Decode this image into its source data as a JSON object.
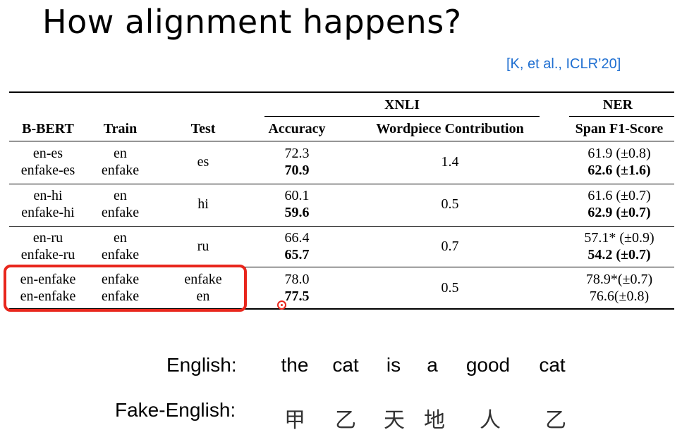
{
  "slide": {
    "title": "How alignment happens?",
    "citation": "[K, et al., ICLR’20]"
  },
  "table": {
    "group_headers": {
      "xnli": "XNLI",
      "ner": "NER"
    },
    "headers": {
      "bbert": "B-BERT",
      "train": "Train",
      "test": "Test",
      "accuracy": "Accuracy",
      "wordpiece": "Wordpiece Contribution",
      "spanf1": "Span F1-Score"
    },
    "rows": [
      {
        "bbert": [
          "en-es",
          "enfake-es"
        ],
        "train": [
          "en",
          "enfake"
        ],
        "test": "es",
        "acc": [
          "72.3",
          "70.9"
        ],
        "wp": "1.4",
        "f1": [
          "61.9 (±0.8)",
          "62.6 (±1.6)"
        ]
      },
      {
        "bbert": [
          "en-hi",
          "enfake-hi"
        ],
        "train": [
          "en",
          "enfake"
        ],
        "test": "hi",
        "acc": [
          "60.1",
          "59.6"
        ],
        "wp": "0.5",
        "f1": [
          "61.6 (±0.7)",
          "62.9 (±0.7)"
        ]
      },
      {
        "bbert": [
          "en-ru",
          "enfake-ru"
        ],
        "train": [
          "en",
          "enfake"
        ],
        "test": "ru",
        "acc": [
          "66.4",
          "65.7"
        ],
        "wp": "0.7",
        "f1": [
          "57.1* (±0.9)",
          "54.2 (±0.7)"
        ]
      },
      {
        "bbert": [
          "en-enfake",
          "en-enfake"
        ],
        "train": [
          "enfake",
          "enfake"
        ],
        "test": [
          "enfake",
          "en"
        ],
        "acc": [
          "78.0",
          "77.5"
        ],
        "wp": "0.5",
        "f1": [
          "78.9*(±0.7)",
          "76.6(±0.8)"
        ]
      }
    ]
  },
  "example": {
    "english_label": "English:",
    "fake_label": "Fake-English:",
    "english_words": [
      "the",
      "cat",
      "is",
      "a",
      "good",
      "cat"
    ],
    "fake_words": [
      "甲",
      "乙",
      "天",
      "地",
      "人",
      "乙"
    ]
  },
  "colors": {
    "highlight": "#e8261c",
    "citation": "#1f6fd1"
  }
}
